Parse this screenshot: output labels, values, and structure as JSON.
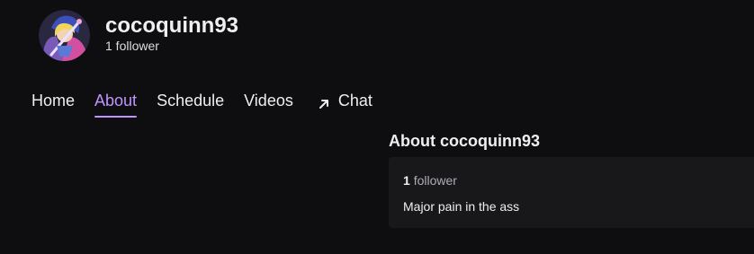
{
  "channel": {
    "name": "cocoquinn93",
    "followers_text": "1 follower"
  },
  "tabs": [
    {
      "label": "Home"
    },
    {
      "label": "About"
    },
    {
      "label": "Schedule"
    },
    {
      "label": "Videos"
    },
    {
      "label": "Chat"
    }
  ],
  "active_tab": "About",
  "about": {
    "title": "About cocoquinn93",
    "follower_count": "1",
    "follower_word": "follower",
    "bio": "Major pain in the ass"
  },
  "colors": {
    "background": "#0e0e10",
    "card": "#18181b",
    "accent": "#bf94ff",
    "text": "#efeff1",
    "muted": "#adadb8"
  },
  "icons": {
    "chat_tab": "external-arrow-icon"
  }
}
